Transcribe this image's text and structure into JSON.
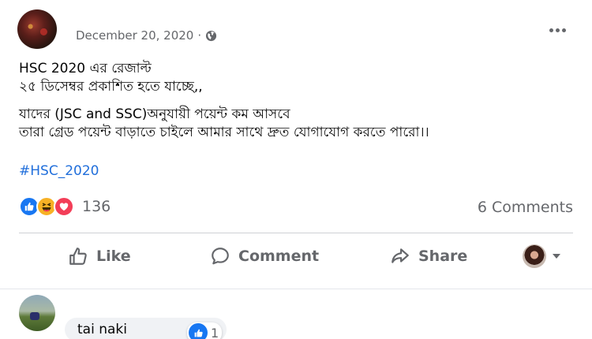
{
  "post": {
    "date": "December 20, 2020",
    "separator": "·",
    "privacy_icon": "globe-icon",
    "menu_icon": "more-horizontal-icon",
    "lines": [
      "HSC 2020 এর রেজাল্ট",
      "২৫ ডিসেম্বর প্রকাশিত হতে যাচ্ছে,,",
      "যাদের (JSC and SSC)অনুযায়ী পয়েন্ট কম আসবে",
      "তারা গ্রেড পয়েন্ট বাড়াতে চাইলে আমার সাথে দ্রুত যোগাযোগ করতে পারো।।"
    ],
    "hashtag": "#HSC_2020"
  },
  "reactions": {
    "types": [
      "like-icon",
      "haha-icon",
      "love-icon"
    ],
    "count": "136",
    "comments": "6 Comments"
  },
  "actions": {
    "like": "Like",
    "comment": "Comment",
    "share": "Share"
  },
  "comment": {
    "text": "tai naki",
    "reaction_count": "1"
  },
  "colors": {
    "link": "#216fdb",
    "like_blue": "#1877f2",
    "haha_yellow": "#f7b125",
    "love_red": "#f33e58",
    "muted": "#65676b"
  }
}
